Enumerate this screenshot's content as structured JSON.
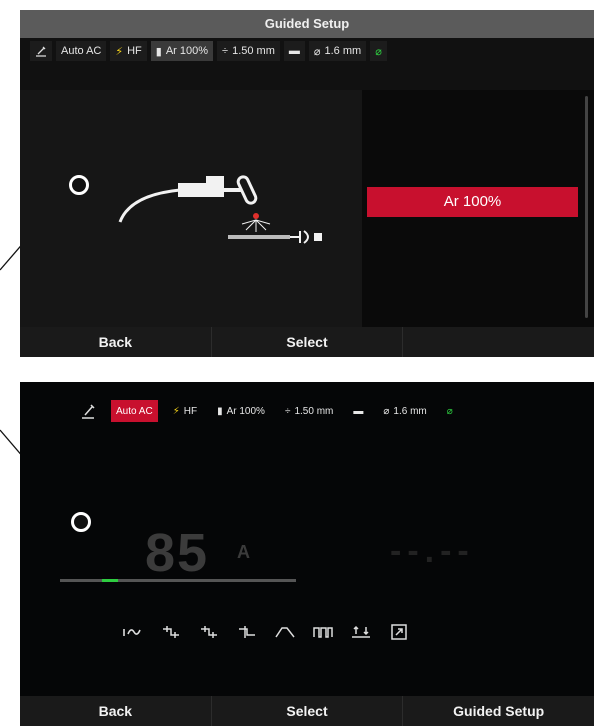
{
  "screen1": {
    "title": "Guided Setup",
    "status": {
      "auto_ac": "Auto AC",
      "hf": "HF",
      "gas": "Ar 100%",
      "thickness": "1.50 mm",
      "diameter": "1.6 mm"
    },
    "selected_option": "Ar 100%",
    "bottom": {
      "back": "Back",
      "select": "Select",
      "third": ""
    }
  },
  "screen2": {
    "status": {
      "auto_ac": "Auto AC",
      "hf": "HF",
      "gas": "Ar 100%",
      "thickness": "1.50 mm",
      "diameter": "1.6 mm"
    },
    "current_value": "85",
    "current_unit": "A",
    "secondary_value": "--.--",
    "bottom": {
      "back": "Back",
      "select": "Select",
      "guided_setup": "Guided Setup"
    }
  },
  "colors": {
    "accent_red": "#c8102e",
    "green": "#2ecc40",
    "bolt_yellow": "#f5d31a"
  },
  "icons": [
    "torch-icon",
    "bolt-icon",
    "gas-bottle-icon",
    "thickness-icon",
    "electrode-icon",
    "diameter-icon",
    "wave-icon",
    "pulse-icon",
    "expand-icon"
  ]
}
